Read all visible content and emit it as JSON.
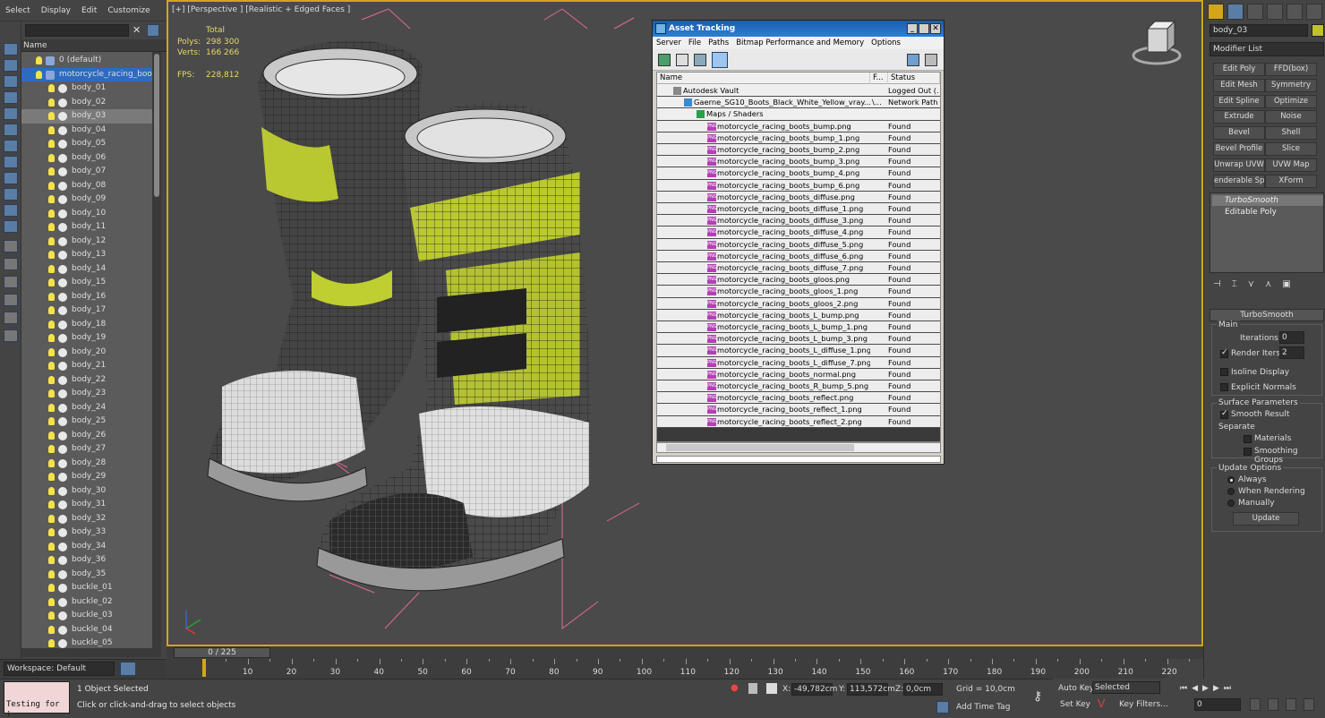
{
  "menu": [
    "Select",
    "Display",
    "Edit",
    "Customize"
  ],
  "scene_explorer": {
    "column_name": "Name",
    "layer": "0 (default)",
    "group": "motorcycle_racing_boots",
    "items": [
      "body_01",
      "body_02",
      "body_03",
      "body_04",
      "body_05",
      "body_06",
      "body_07",
      "body_08",
      "body_09",
      "body_10",
      "body_11",
      "body_12",
      "body_13",
      "body_14",
      "body_15",
      "body_16",
      "body_17",
      "body_18",
      "body_19",
      "body_20",
      "body_21",
      "body_22",
      "body_23",
      "body_24",
      "body_25",
      "body_26",
      "body_27",
      "body_28",
      "body_29",
      "body_30",
      "body_31",
      "body_32",
      "body_33",
      "body_34",
      "body_36",
      "body_35",
      "buckle_01",
      "buckle_02",
      "buckle_03",
      "buckle_04",
      "buckle_05"
    ],
    "selected_item": "body_03"
  },
  "workspace": "Workspace: Default",
  "viewport": {
    "label": "[+] [Perspective ] [Realistic + Edged Faces ]",
    "stats": {
      "total_label": "Total",
      "polys_label": "Polys:",
      "polys": "298 300",
      "verts_label": "Verts:",
      "verts": "166 266",
      "fps_label": "FPS:",
      "fps": "228,812"
    }
  },
  "time_slider": {
    "label": "0 / 225",
    "ticks": [
      "10",
      "20",
      "30",
      "40",
      "50",
      "60",
      "70",
      "80",
      "90",
      "100",
      "110",
      "120",
      "130",
      "140",
      "150",
      "160",
      "170",
      "180",
      "190",
      "200",
      "210",
      "220"
    ]
  },
  "status": {
    "maxscript": "Testing for ;",
    "message": "1 Object Selected",
    "prompt": "Click or click-and-drag to select objects",
    "x_label": "X:",
    "x": "-49,782cm",
    "y_label": "Y:",
    "y": "113,572cm",
    "z_label": "Z:",
    "z": "0,0cm",
    "grid": "Grid = 10,0cm",
    "add_time_tag": "Add Time Tag",
    "auto_key": "Auto Key",
    "set_key": "Set Key",
    "selected": "Selected",
    "key_filters": "Key Filters...",
    "frame": "0"
  },
  "command_panel": {
    "object_name": "body_03",
    "modifier_list": "Modifier List",
    "buttons": [
      "Edit Poly",
      "FFD(box)",
      "Edit Mesh",
      "Symmetry",
      "Edit Spline",
      "Optimize",
      "Extrude",
      "Noise",
      "Bevel",
      "Shell",
      "Bevel Profile",
      "Slice",
      "Unwrap UVW",
      "UVW Map",
      "enderable Splin",
      "XForm"
    ],
    "stack": [
      "TurboSmooth",
      "Editable Poly"
    ],
    "turbosmooth": {
      "title": "TurboSmooth",
      "main": "Main",
      "iterations_label": "Iterations:",
      "iterations": "0",
      "render_iters_label": "Render Iters:",
      "render_iters": "2",
      "isoline": "Isoline Display",
      "explicit": "Explicit Normals",
      "surface": "Surface Parameters",
      "smooth_result": "Smooth Result",
      "separate": "Separate",
      "materials": "Materials",
      "smoothing_groups": "Smoothing Groups",
      "update_options": "Update Options",
      "always": "Always",
      "when_rendering": "When Rendering",
      "manually": "Manually",
      "update": "Update"
    }
  },
  "asset_tracking": {
    "title": "Asset Tracking",
    "menu": [
      "Server",
      "File",
      "Paths",
      "Bitmap Performance and Memory",
      "Options"
    ],
    "columns": [
      "Name",
      "F...",
      "Status"
    ],
    "vault": {
      "name": "Autodesk Vault",
      "status": "Logged Out (..."
    },
    "file": {
      "name": "Gaerne_SG10_Boots_Black_White_Yellow_vray....",
      "f": "\\...",
      "status": "Network Path"
    },
    "folder": "Maps / Shaders",
    "maps": [
      "motorcycle_racing_boots_bump.png",
      "motorcycle_racing_boots_bump_1.png",
      "motorcycle_racing_boots_bump_2.png",
      "motorcycle_racing_boots_bump_3.png",
      "motorcycle_racing_boots_bump_4.png",
      "motorcycle_racing_boots_bump_6.png",
      "motorcycle_racing_boots_diffuse.png",
      "motorcycle_racing_boots_diffuse_1.png",
      "motorcycle_racing_boots_diffuse_3.png",
      "motorcycle_racing_boots_diffuse_4.png",
      "motorcycle_racing_boots_diffuse_5.png",
      "motorcycle_racing_boots_diffuse_6.png",
      "motorcycle_racing_boots_diffuse_7.png",
      "motorcycle_racing_boots_gloos.png",
      "motorcycle_racing_boots_gloos_1.png",
      "motorcycle_racing_boots_gloos_2.png",
      "motorcycle_racing_boots_L_bump.png",
      "motorcycle_racing_boots_L_bump_1.png",
      "motorcycle_racing_boots_L_bump_3.png",
      "motorcycle_racing_boots_L_diffuse_1.png",
      "motorcycle_racing_boots_L_diffuse_7.png",
      "motorcycle_racing_boots_normal.png",
      "motorcycle_racing_boots_R_bump_5.png",
      "motorcycle_racing_boots_reflect.png",
      "motorcycle_racing_boots_reflect_1.png",
      "motorcycle_racing_boots_reflect_2.png"
    ],
    "found": "Found",
    "png_badge": "PNG"
  },
  "colors": {
    "viewport_border": "#d4a517",
    "boot_accent": "#c6d630",
    "asset_title": "#1b5ea7",
    "stat_text": "#e6d86a"
  }
}
